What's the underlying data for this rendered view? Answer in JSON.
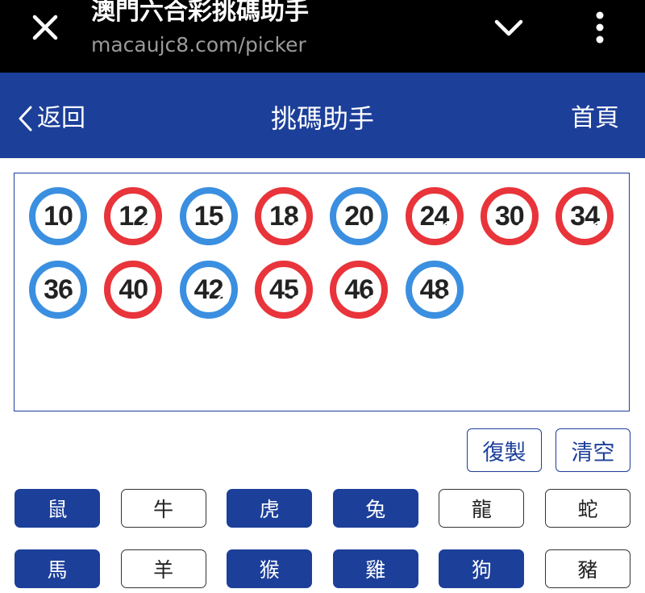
{
  "browser": {
    "title": "澳門六合彩挑碼助手",
    "url": "macaujc8.com/picker"
  },
  "header": {
    "back_label": "返回",
    "title": "挑碼助手",
    "home_label": "首頁"
  },
  "selected_numbers": [
    {
      "label": "10",
      "color": "blue"
    },
    {
      "label": "12",
      "color": "red"
    },
    {
      "label": "15",
      "color": "blue"
    },
    {
      "label": "18",
      "color": "red"
    },
    {
      "label": "20",
      "color": "blue"
    },
    {
      "label": "24",
      "color": "red"
    },
    {
      "label": "30",
      "color": "red"
    },
    {
      "label": "34",
      "color": "red"
    },
    {
      "label": "36",
      "color": "blue"
    },
    {
      "label": "40",
      "color": "red"
    },
    {
      "label": "42",
      "color": "blue"
    },
    {
      "label": "45",
      "color": "red"
    },
    {
      "label": "46",
      "color": "red"
    },
    {
      "label": "48",
      "color": "blue"
    }
  ],
  "actions": {
    "copy_label": "復製",
    "clear_label": "清空"
  },
  "zodiacs": [
    {
      "label": "鼠",
      "selected": true
    },
    {
      "label": "牛",
      "selected": false
    },
    {
      "label": "虎",
      "selected": true
    },
    {
      "label": "兔",
      "selected": true
    },
    {
      "label": "龍",
      "selected": false
    },
    {
      "label": "蛇",
      "selected": false
    },
    {
      "label": "馬",
      "selected": true
    },
    {
      "label": "羊",
      "selected": false
    },
    {
      "label": "猴",
      "selected": true
    },
    {
      "label": "雞",
      "selected": true
    },
    {
      "label": "狗",
      "selected": true
    },
    {
      "label": "豬",
      "selected": false
    }
  ],
  "colors": {
    "brand": "#1c3f99",
    "red_ball": "#e8343a",
    "blue_ball": "#3b8fe0"
  },
  "icons": {
    "close": "close-icon",
    "chevron": "chevron-down-icon",
    "menu": "more-vertical-icon",
    "back": "chevron-left-icon"
  }
}
